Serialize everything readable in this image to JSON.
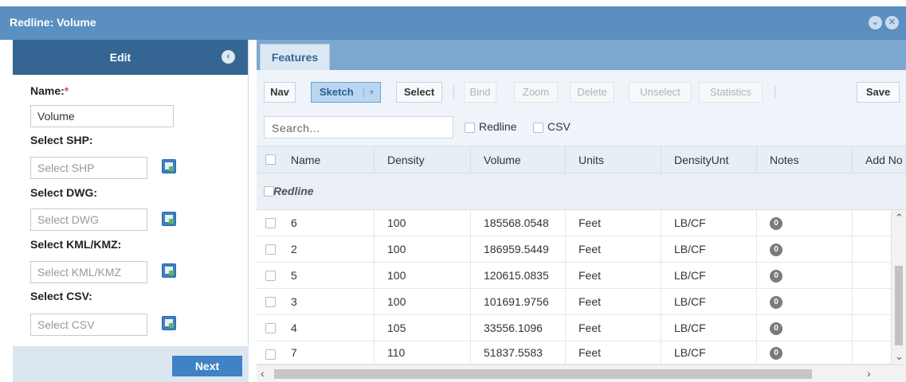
{
  "window": {
    "title": "Redline: Volume",
    "collapse_icon": "chevron-down-icon",
    "close_icon": "close-icon",
    "accent": "#5b8fc0"
  },
  "edit_panel": {
    "title": "Edit",
    "name_label": "Name:",
    "name_required": "*",
    "name_value": "Volume",
    "shp_label": "Select SHP:",
    "shp_placeholder": "Select SHP",
    "dwg_label": "Select DWG:",
    "dwg_placeholder": "Select DWG",
    "kml_label": "Select KML/KMZ:",
    "kml_placeholder": "Select KML/KMZ",
    "csv_label": "Select CSV:",
    "csv_placeholder": "Select CSV",
    "next_label": "Next"
  },
  "features": {
    "tab_label": "Features",
    "toolbar": {
      "nav": "Nav",
      "sketch": "Sketch",
      "select": "Select",
      "bind": "Bind",
      "zoom": "Zoom",
      "delete": "Delete",
      "unselect": "Unselect",
      "statistics": "Statistics",
      "save": "Save"
    },
    "search_placeholder": "Search...",
    "filter_redline": "Redline",
    "filter_csv": "CSV"
  },
  "grid": {
    "columns": [
      "Name",
      "Density",
      "Volume",
      "Units",
      "DensityUnt",
      "Notes",
      "Add No"
    ],
    "group_label": "Redline",
    "rows": [
      {
        "name": "6",
        "density": "100",
        "volume": "185568.0548",
        "units": "Feet",
        "density_unit": "LB/CF",
        "notes": "0"
      },
      {
        "name": "2",
        "density": "100",
        "volume": "186959.5449",
        "units": "Feet",
        "density_unit": "LB/CF",
        "notes": "0"
      },
      {
        "name": "5",
        "density": "100",
        "volume": "120615.0835",
        "units": "Feet",
        "density_unit": "LB/CF",
        "notes": "0"
      },
      {
        "name": "3",
        "density": "100",
        "volume": "101691.9756",
        "units": "Feet",
        "density_unit": "LB/CF",
        "notes": "0"
      },
      {
        "name": "4",
        "density": "105",
        "volume": "33556.1096",
        "units": "Feet",
        "density_unit": "LB/CF",
        "notes": "0"
      },
      {
        "name": "7",
        "density": "110",
        "volume": "51837.5583",
        "units": "Feet",
        "density_unit": "LB/CF",
        "notes": "0"
      }
    ]
  }
}
